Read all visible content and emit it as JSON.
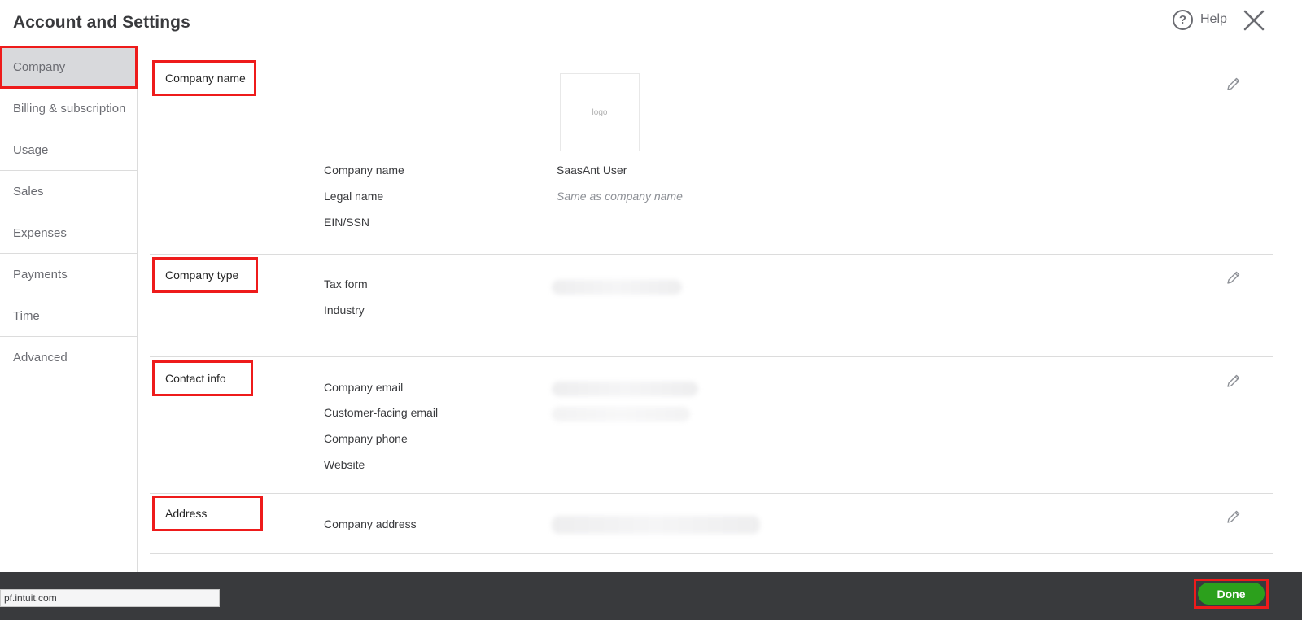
{
  "header": {
    "title": "Account and Settings",
    "help_label": "Help"
  },
  "sidebar": {
    "items": [
      {
        "label": "Company"
      },
      {
        "label": "Billing & subscription"
      },
      {
        "label": "Usage"
      },
      {
        "label": "Sales"
      },
      {
        "label": "Expenses"
      },
      {
        "label": "Payments"
      },
      {
        "label": "Time"
      },
      {
        "label": "Advanced"
      }
    ],
    "active": "Company"
  },
  "sections": {
    "company_name": {
      "title": "Company name",
      "logo_text": "logo",
      "fields": [
        {
          "label": "Company name",
          "value": "SaasAnt User"
        },
        {
          "label": "Legal name",
          "value": "Same as company name"
        },
        {
          "label": "EIN/SSN",
          "value": ""
        }
      ]
    },
    "company_type": {
      "title": "Company type",
      "fields": [
        {
          "label": "Tax form"
        },
        {
          "label": "Industry"
        }
      ]
    },
    "contact_info": {
      "title": "Contact info",
      "fields": [
        {
          "label": "Company email"
        },
        {
          "label": "Customer-facing email"
        },
        {
          "label": "Company phone"
        },
        {
          "label": "Website"
        }
      ]
    },
    "address": {
      "title": "Address",
      "fields": [
        {
          "label": "Company address"
        }
      ]
    }
  },
  "footer": {
    "status_url": "pf.intuit.com",
    "done_label": "Done"
  },
  "colors": {
    "accent_green": "#2ca01c",
    "highlight_red": "#ee1b1b",
    "footer_bg": "#393a3d"
  }
}
